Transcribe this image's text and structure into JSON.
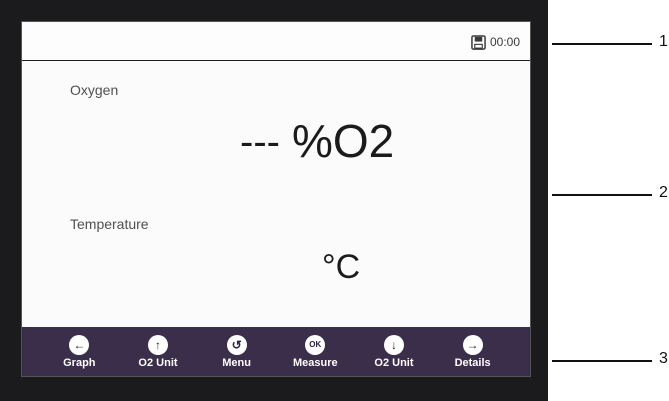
{
  "status": {
    "time": "00:00",
    "save_icon": "save-icon"
  },
  "main": {
    "oxygen_label": "Oxygen",
    "oxygen_value": "---",
    "oxygen_unit": "%O2",
    "temperature_label": "Temperature",
    "temperature_unit": "°C"
  },
  "toolbar": {
    "buttons": [
      {
        "label": "Graph",
        "icon": "arrow-left-icon"
      },
      {
        "label": "O2 Unit",
        "icon": "arrow-up-icon"
      },
      {
        "label": "Menu",
        "icon": "return-icon"
      },
      {
        "label": "Measure",
        "icon": "ok-icon"
      },
      {
        "label": "O2 Unit",
        "icon": "arrow-down-icon"
      },
      {
        "label": "Details",
        "icon": "arrow-right-icon"
      }
    ]
  },
  "callouts": [
    "1",
    "2",
    "3"
  ],
  "colors": {
    "bezel": "#1b1b1d",
    "toolbar": "#3a2e4a",
    "screen": "#fbfbfb"
  }
}
